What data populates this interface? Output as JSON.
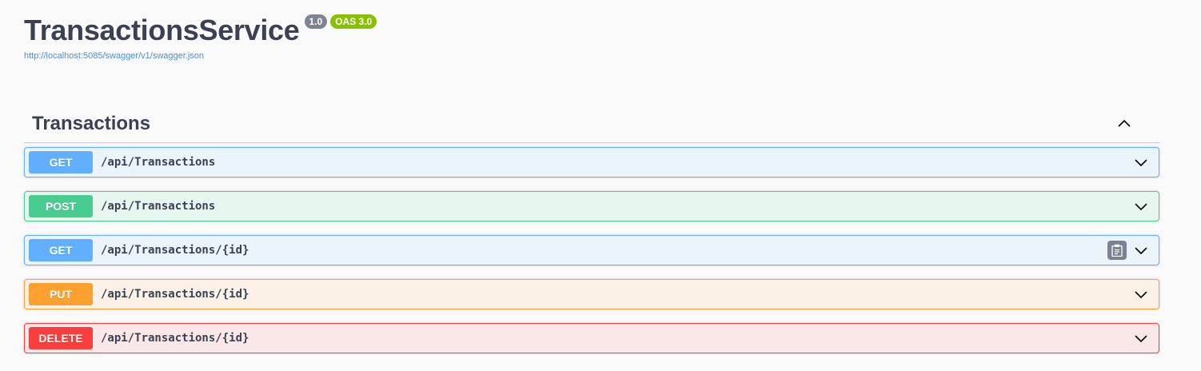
{
  "info": {
    "title": "TransactionsService",
    "version": "1.0",
    "oas": "OAS 3.0",
    "spec_url": "http://localhost:5085/swagger/v1/swagger.json"
  },
  "tag": {
    "name": "Transactions",
    "expanded": true
  },
  "operations": [
    {
      "method": "GET",
      "path": "/api/Transactions",
      "color": "#61affe"
    },
    {
      "method": "POST",
      "path": "/api/Transactions",
      "color": "#49cc90"
    },
    {
      "method": "GET",
      "path": "/api/Transactions/{id}",
      "color": "#61affe",
      "copy_icon": "clipboard-icon"
    },
    {
      "method": "PUT",
      "path": "/api/Transactions/{id}",
      "color": "#fca130"
    },
    {
      "method": "DELETE",
      "path": "/api/Transactions/{id}",
      "color": "#f93e3e"
    }
  ]
}
